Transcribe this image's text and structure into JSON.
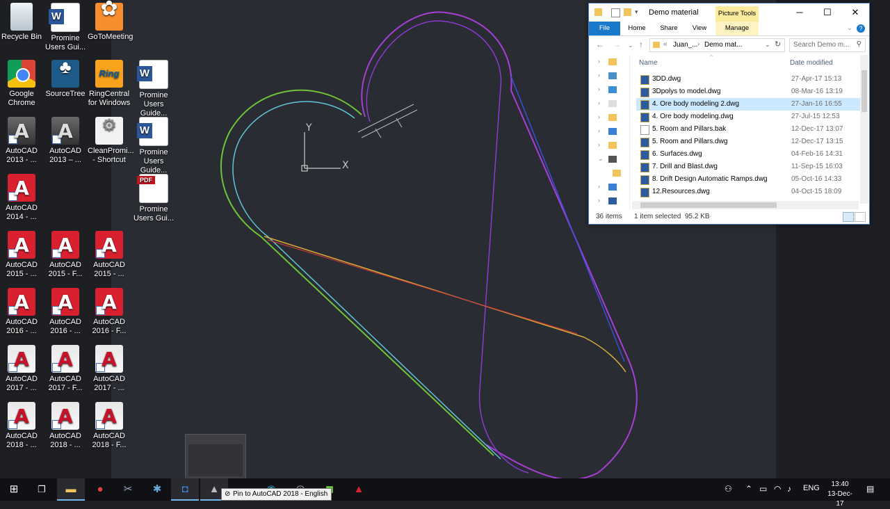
{
  "desktop_icons": [
    {
      "label": "Recycle Bin",
      "icon": "recycle-bin-icon"
    },
    {
      "label": "Google\nChrome",
      "icon": "chrome-icon"
    },
    {
      "label": "AutoCAD\n2013 - ...",
      "icon": "autocad-2013-icon"
    },
    {
      "label": "AutoCAD\n2014 - ...",
      "icon": "autocad-icon"
    },
    {
      "label": "AutoCAD\n2015 - ...",
      "icon": "autocad-icon"
    },
    {
      "label": "AutoCAD\n2016 - ...",
      "icon": "autocad-icon"
    },
    {
      "label": "AutoCAD\n2017 - ...",
      "icon": "autocad-icon"
    },
    {
      "label": "AutoCAD\n2018 - ...",
      "icon": "autocad-icon"
    },
    {
      "label": "Promine\nUsers Gui...",
      "icon": "word-doc-icon"
    },
    {
      "label": "SourceTree",
      "icon": "sourcetree-icon"
    },
    {
      "label": "AutoCAD\n2013 – ...",
      "icon": "autocad-2013-icon"
    },
    {
      "label": "AutoCAD\n2015 - F...",
      "icon": "autocad-icon"
    },
    {
      "label": "AutoCAD\n2016 - ...",
      "icon": "autocad-icon"
    },
    {
      "label": "AutoCAD\n2017 - F...",
      "icon": "autocad-icon"
    },
    {
      "label": "AutoCAD\n2018 - ...",
      "icon": "autocad-icon"
    },
    {
      "label": "GoToMeeting",
      "icon": "gotomeeting-icon"
    },
    {
      "label": "RingCentral\nfor Windows",
      "icon": "ringcentral-icon"
    },
    {
      "label": "CleanPromi...\n- Shortcut",
      "icon": "cleanpromine-icon"
    },
    {
      "label": "AutoCAD\n2015 - ...",
      "icon": "autocad-icon"
    },
    {
      "label": "AutoCAD\n2016 - F...",
      "icon": "autocad-icon"
    },
    {
      "label": "AutoCAD\n2017 - ...",
      "icon": "autocad-icon"
    },
    {
      "label": "AutoCAD\n2018 - F...",
      "icon": "autocad-icon"
    },
    {
      "label": "Promine\nUsers Guide...",
      "icon": "word-doc-icon"
    },
    {
      "label": "Promine\nUsers Guide...",
      "icon": "word-doc-icon"
    },
    {
      "label": "Promine\nUsers Gui...",
      "icon": "pdf-icon"
    }
  ],
  "cad": {
    "ucs_x": "X",
    "ucs_y": "Y",
    "colors": {
      "background": "#2a2c33",
      "purple": "#a63fd6",
      "green": "#6fc33a",
      "cyan": "#5fc4d6",
      "yellow": "#d9a93a",
      "red": "#c23a3a",
      "blue": "#3a4fd6"
    }
  },
  "explorer": {
    "title": "Demo material",
    "context_tab": "Picture Tools",
    "tabs": [
      "File",
      "Home",
      "Share",
      "View",
      "Manage"
    ],
    "address": {
      "crumb1": "Juan_...",
      "crumb2": "Demo mat..."
    },
    "search_placeholder": "Search Demo m...",
    "columns": {
      "name": "Name",
      "date": "Date modified"
    },
    "files": [
      {
        "name": "3DD.dwg",
        "date": "27-Apr-17 15:13",
        "type": "dwg"
      },
      {
        "name": "3Dpolys to model.dwg",
        "date": "08-Mar-16 13:19",
        "type": "dwg"
      },
      {
        "name": "4. Ore body modeling 2.dwg",
        "date": "27-Jan-16 16:55",
        "type": "dwg",
        "selected": true
      },
      {
        "name": "4. Ore body modeling.dwg",
        "date": "27-Jul-15 12:53",
        "type": "dwg"
      },
      {
        "name": "5. Room and Pillars.bak",
        "date": "12-Dec-17 13:07",
        "type": "bak"
      },
      {
        "name": "5. Room and Pillars.dwg",
        "date": "12-Dec-17 13:15",
        "type": "dwg"
      },
      {
        "name": "6. Surfaces.dwg",
        "date": "04-Feb-16 14:31",
        "type": "dwg"
      },
      {
        "name": "7. Drill and Blast.dwg",
        "date": "11-Sep-15 16:03",
        "type": "dwg"
      },
      {
        "name": "8. Drift Design Automatic Ramps.dwg",
        "date": "05-Oct-16 14:33",
        "type": "dwg"
      },
      {
        "name": "12.Resources.dwg",
        "date": "04-Oct-15 18:09",
        "type": "dwg"
      }
    ],
    "status": {
      "items": "36 items",
      "selected": "1 item selected",
      "size": "95.2 KB"
    },
    "colors": {
      "accent": "#1979ca",
      "selection": "#cce8ff",
      "context_tab": "#fbeb9c"
    }
  },
  "taskbar": {
    "tooltip": "Pin to AutoCAD 2018 - English",
    "language": "ENG",
    "time": "13:40",
    "date": "13-Dec-17"
  }
}
